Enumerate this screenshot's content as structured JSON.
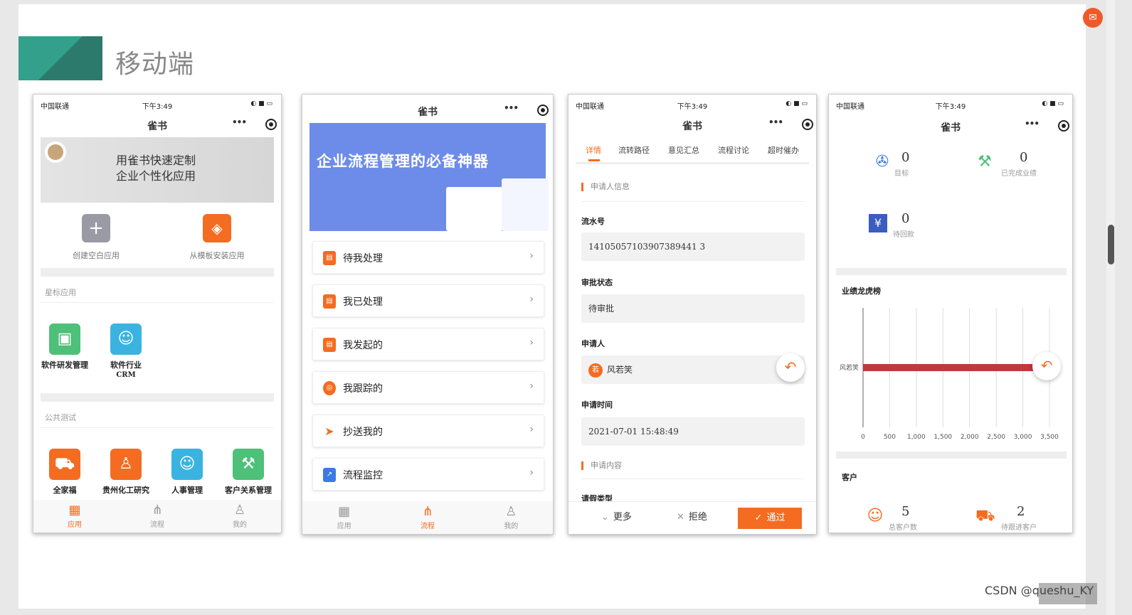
{
  "slide": {
    "title": "移动端",
    "watermark": "CSDN @queshu_KY"
  },
  "status": {
    "carrier": "中国联通",
    "time": "下午3:49"
  },
  "app_name": "雀书",
  "phone1": {
    "banner": [
      "用雀书快速定制",
      "企业个性化应用"
    ],
    "quick_actions": [
      "创建空白应用",
      "从模板安装应用"
    ],
    "starred_title": "星标应用",
    "starred_apps": [
      {
        "label": "软件研发管理"
      },
      {
        "label": "软件行业CRM",
        "label_line1": "软件行业",
        "label_line2": "CRM"
      }
    ],
    "public_title": "公共测试",
    "public_apps": [
      "全家福",
      "贵州化工研究",
      "人事管理",
      "客户关系管理"
    ],
    "tabs": [
      "应用",
      "流程",
      "我的"
    ]
  },
  "phone2": {
    "banner": "企业流程管理的必备神器",
    "menu": [
      "待我处理",
      "我已处理",
      "我发起的",
      "我跟踪的",
      "抄送我的",
      "流程监控"
    ],
    "tabs": [
      "应用",
      "流程",
      "我的"
    ]
  },
  "phone3": {
    "tabs": [
      "详情",
      "流转路径",
      "意见汇总",
      "流程讨论",
      "超时催办"
    ],
    "group1": "申请人信息",
    "serial_label": "流水号",
    "serial_value": "14105057103907389441 3",
    "status_label": "审批状态",
    "status_value": "待审批",
    "applicant_label": "申请人",
    "applicant_avatar": "若",
    "applicant_value": "风若笑",
    "time_label": "申请时间",
    "time_value": "2021-07-01 15:48:49",
    "group2": "申请内容",
    "leave_label": "请假类型",
    "actions": {
      "more": "更多",
      "reject": "拒绝",
      "approve": "通过"
    }
  },
  "phone4": {
    "stats": [
      {
        "value": "0",
        "label": "目标"
      },
      {
        "value": "0",
        "label": "已完成业绩"
      },
      {
        "value": "0",
        "label": "待回款"
      }
    ],
    "leaderboard_title": "业绩龙虎榜",
    "chart_data": {
      "type": "bar",
      "orientation": "horizontal",
      "categories": [
        "风若笑"
      ],
      "values": [
        3200
      ],
      "x_ticks": [
        "0",
        "500",
        "1,000",
        "1,500",
        "2,000",
        "2,500",
        "3,000",
        "3,500"
      ],
      "xlim": [
        0,
        3500
      ],
      "bar_color": "#c0393b"
    },
    "customer_title": "客户",
    "customers": [
      {
        "value": "5",
        "label": "总客户数"
      },
      {
        "value": "2",
        "label": "待跟进客户"
      }
    ]
  },
  "colors": {
    "accent": "#f36c21",
    "teal": "#33a08b"
  }
}
